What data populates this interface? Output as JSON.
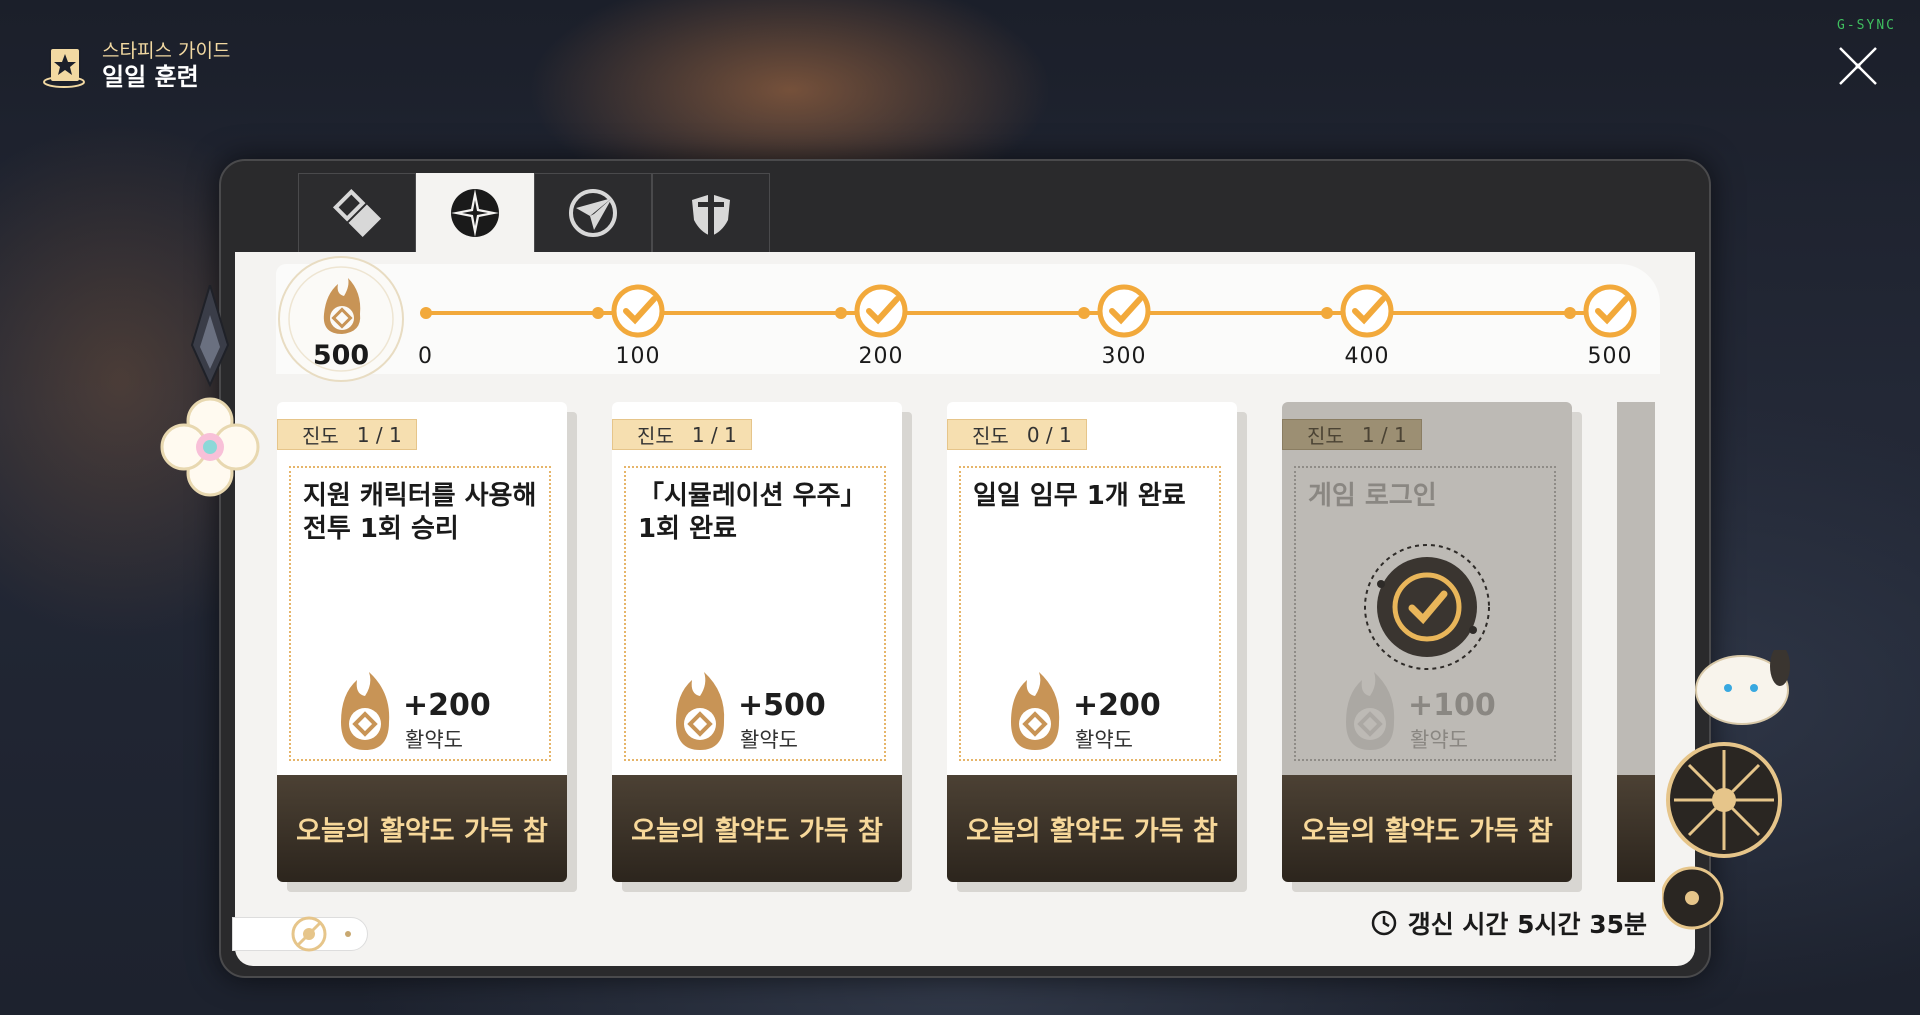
{
  "header": {
    "subtitle": "스타피스 가이드",
    "title": "일일 훈련"
  },
  "overlay": {
    "gsync": "G-SYNC"
  },
  "tabs": [
    {
      "name": "tab-guide",
      "icon": "diamond-blocks-icon",
      "active": false
    },
    {
      "name": "tab-daily",
      "icon": "star-compass-icon",
      "active": true
    },
    {
      "name": "tab-event",
      "icon": "paper-plane-icon",
      "active": false
    },
    {
      "name": "tab-tech",
      "icon": "shield-icon",
      "active": false
    }
  ],
  "progress": {
    "total": "500",
    "milestones": [
      "0",
      "100",
      "200",
      "300",
      "400",
      "500"
    ],
    "claimed": [
      100,
      200,
      300,
      400,
      500
    ]
  },
  "cards": [
    {
      "progress_label": "진도",
      "progress_value": "1 / 1",
      "title": "지원 캐릭터를 사용해 전투 1회 승리",
      "reward_amount": "+200",
      "reward_label": "활약도",
      "button": "오늘의 활약도 가득 참",
      "done": false
    },
    {
      "progress_label": "진도",
      "progress_value": "1 / 1",
      "title": "「시뮬레이션 우주」 1회 완료",
      "reward_amount": "+500",
      "reward_label": "활약도",
      "button": "오늘의 활약도 가득 참",
      "done": false
    },
    {
      "progress_label": "진도",
      "progress_value": "0 / 1",
      "title": "일일 임무 1개 완료",
      "reward_amount": "+200",
      "reward_label": "활약도",
      "button": "오늘의 활약도 가득 참",
      "done": false
    },
    {
      "progress_label": "진도",
      "progress_value": "1 / 1",
      "title": "게임 로그인",
      "reward_amount": "+100",
      "reward_label": "활약도",
      "button": "오늘의 활약도 가득 참",
      "done": true
    }
  ],
  "refresh": {
    "text": "갱신 시간 5시간  35분"
  },
  "colors": {
    "accent": "#f2a93b",
    "button_text": "#f7d89a",
    "button_bg": "#3a3128"
  }
}
